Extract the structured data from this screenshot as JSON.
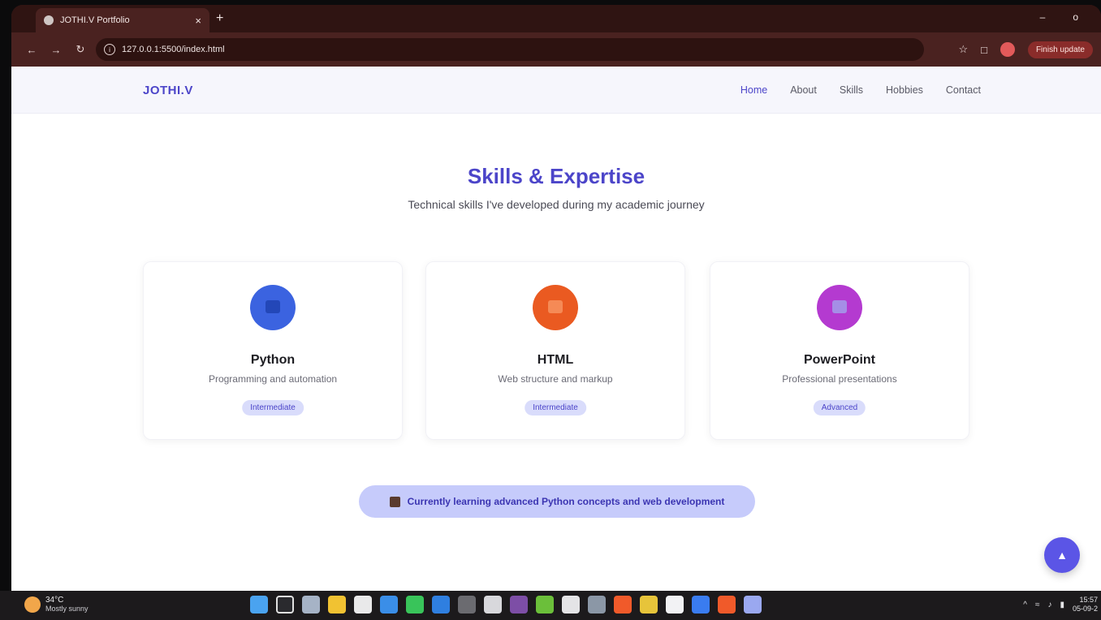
{
  "browser": {
    "tab_title": "JOTHI.V Portfolio",
    "tab_close": "×",
    "new_tab": "+",
    "url": "127.0.0.1:5500/index.html",
    "finish_update": "Finish update",
    "window_controls": [
      "–",
      "o"
    ]
  },
  "site": {
    "logo": "JOTHI.V",
    "nav": [
      "Home",
      "About",
      "Skills",
      "Hobbies",
      "Contact"
    ],
    "active_nav": "Home",
    "skills_title": "Skills & Expertise",
    "skills_subtitle": "Technical skills I've developed during my academic journey",
    "cards": [
      {
        "name": "Python",
        "desc": "Programming and automation",
        "level": "Intermediate",
        "color": "#3b63e0",
        "inner": "#2347b8"
      },
      {
        "name": "HTML",
        "desc": "Web structure and markup",
        "level": "Intermediate",
        "color": "#ea5a21",
        "inner": "#f58a56"
      },
      {
        "name": "PowerPoint",
        "desc": "Professional presentations",
        "level": "Advanced",
        "color": "#b43ad0",
        "inner": "#a58ee6"
      }
    ],
    "learning_banner": "Currently learning advanced Python concepts and web development",
    "scroll_top_icon": "chevron-up-icon"
  },
  "taskbar": {
    "temperature": "34°C",
    "condition": "Mostly sunny",
    "time": "15:57",
    "date": "05-09-2"
  }
}
